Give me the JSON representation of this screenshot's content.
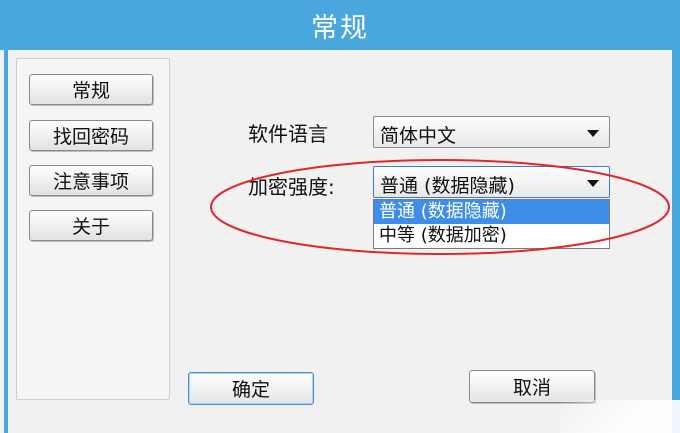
{
  "window": {
    "title": "常规",
    "accent": "#4aa7dd"
  },
  "sidebar": {
    "items": [
      {
        "label": "常规"
      },
      {
        "label": "找回密码"
      },
      {
        "label": "注意事项"
      },
      {
        "label": "关于"
      }
    ]
  },
  "settings": {
    "language_label": "软件语言",
    "language_value": "简体中文",
    "encryption_label": "加密强度:",
    "encryption_value": "普通 (数据隐藏)",
    "encryption_options": [
      {
        "label": "普通 (数据隐藏)",
        "selected": true
      },
      {
        "label": "中等 (数据加密)",
        "selected": false
      }
    ]
  },
  "footer": {
    "ok_label": "确定",
    "cancel_label": "取消"
  },
  "annotation": {
    "color": "#e3262b",
    "shape": "ellipse"
  },
  "icons": [
    "dropdown-arrow-icon"
  ]
}
